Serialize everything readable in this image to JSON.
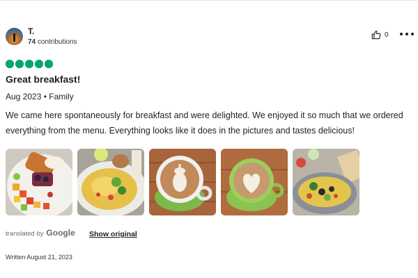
{
  "reviewer": {
    "name": "T.",
    "contributions_count": "74",
    "contributions_label": "contributions"
  },
  "helpful": {
    "count": "0",
    "icon": "thumbs-up-icon"
  },
  "more_icon": "more-options-icon",
  "rating": {
    "value": 5,
    "max": 5,
    "color": "#00aa6c"
  },
  "review": {
    "title": "Great breakfast!",
    "meta": "Aug 2023 • Family",
    "text": "We came here spontaneously for breakfast and were delighted. We enjoyed it so much that we ordered everything from the menu. Everything looks like it does in the pictures and tastes delicious!"
  },
  "translation": {
    "translated_by": "translated by",
    "provider": "Google",
    "show_original": "Show original"
  },
  "written_date": "Written August 21, 2023"
}
